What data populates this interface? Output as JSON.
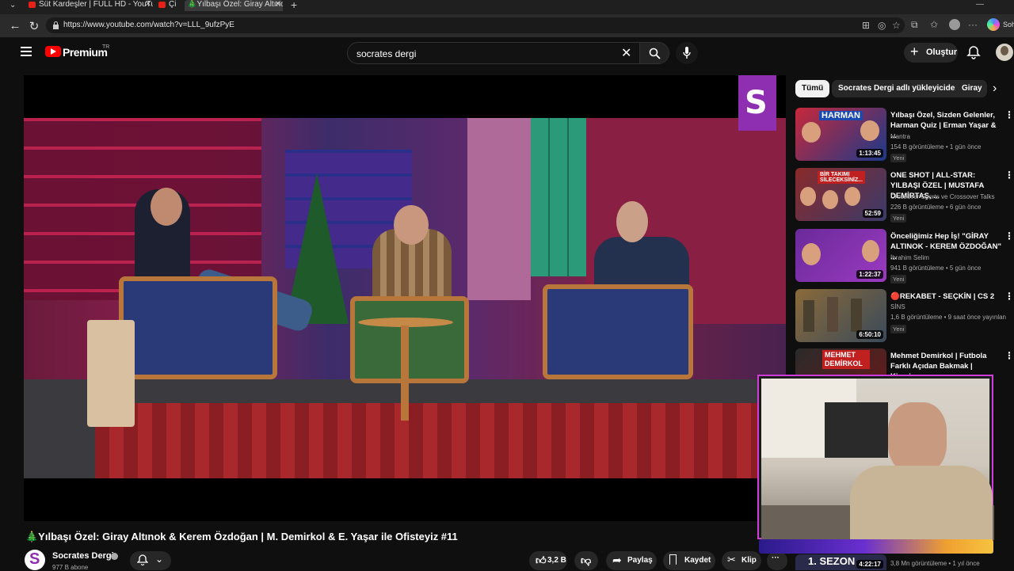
{
  "browser": {
    "tabs": [
      {
        "label": "Süt Kardeşler | FULL HD - YouTube",
        "active": false
      },
      {
        "label": "Çi",
        "active": false
      },
      {
        "label": "🎄Yılbaşı Özel: Giray Altınok &",
        "active": true
      }
    ],
    "new_tab": "+",
    "url": "https://www.youtube.com/watch?v=LLL_9ufzPyE",
    "profile_label": "Soh"
  },
  "header": {
    "brand": "Premium",
    "region": "TR",
    "search_value": "socrates dergi",
    "clear": "✕",
    "create_label": "Oluştur"
  },
  "video": {
    "title": "🎄Yılbaşı Özel: Giray Altınok & Kerem Özdoğan | M. Demirkol & E. Yaşar ile Ofisteyiz #11",
    "channel": "Socrates Dergi",
    "subscribers": "977 B abone",
    "likes": "3,2 B",
    "share_label": "Paylaş",
    "save_label": "Kaydet",
    "clip_label": "Klip",
    "more": "···"
  },
  "chips": {
    "items": [
      "Tümü",
      "Socrates Dergi adlı yükleyiciden",
      "Giray"
    ]
  },
  "recommendations": [
    {
      "title": "Yılbaşı Özel, Sizden Gelenler, Harman Quiz | Erman Yaşar & ...",
      "channel": "Mantra",
      "meta": "154 B görüntüleme • 1 gün önce",
      "badge": "Yeni",
      "duration": "1:13:45"
    },
    {
      "title": "ONE SHOT | ALL-STAR: YILBAŞI ÖZEL | MUSTAFA DEMİRTAŞ, ...",
      "channel": "Crossover Sports ve Crossover Talks",
      "meta": "226 B görüntüleme • 6 gün önce",
      "badge": "Yeni",
      "duration": "52:59"
    },
    {
      "title": "Önceliğimiz Hep İş! \"GİRAY ALTINOK - KEREM ÖZDOĞAN\" ...",
      "channel": "İbrahim Selim",
      "meta": "941 B görüntüleme • 5 gün önce",
      "badge": "Yeni",
      "duration": "1:22:37"
    },
    {
      "title": "🔴REKABET - SEÇKİN | CS 2",
      "channel": "SİNS",
      "meta": "1,6 B görüntüleme • 9 saat önce yayınlan",
      "badge": "Yeni",
      "duration": "6:50:10"
    },
    {
      "title": "Mehmet Demirkol | Futbola Farklı Açıdan Bakmak | Kimsin...",
      "channel": "",
      "meta": "",
      "badge": "",
      "duration": ""
    },
    {
      "title": "",
      "channel": "",
      "meta": "3,8 Mn görüntüleme • 1 yıl önce",
      "badge": "",
      "duration": "4:22:17"
    }
  ],
  "thumb_texts": {
    "rec1": "HARMAN",
    "rec2": "BİR TAKIMI SİLECEKSİNİZ...",
    "rec5": "MEHMET DEMİRKOL",
    "rec6": "1. SEZON"
  },
  "colors": {
    "brand_red": "#ff0000",
    "channel_purple": "#8d2fb0",
    "cam_border": "#d03cdb"
  }
}
